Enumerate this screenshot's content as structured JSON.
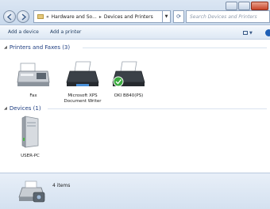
{
  "address": {
    "crumb_overflow": "«",
    "crumb_1": "Hardware and So...",
    "crumb_sep": "▸",
    "crumb_2": "Devices and Printers"
  },
  "search": {
    "placeholder": "Search Devices and Printers"
  },
  "toolbar": {
    "add_device_label": "Add a device",
    "add_printer_label": "Add a printer"
  },
  "groups": {
    "printers": {
      "title": "Printers and Faxes (3)",
      "items": [
        {
          "label": "Fax",
          "icon": "fax-icon"
        },
        {
          "label": "Microsoft XPS Document Writer",
          "icon": "printer-icon"
        },
        {
          "label": "OKI B840(PS)",
          "icon": "printer-default-icon"
        }
      ]
    },
    "devices": {
      "title": "Devices (1)",
      "items": [
        {
          "label": "USER-PC",
          "icon": "computer-tower-icon"
        }
      ]
    }
  },
  "status": {
    "count": "4 items"
  },
  "colors": {
    "group_header": "#1e3d80",
    "link": "#1e3a5f",
    "window_chrome": "#c9d9ec"
  }
}
